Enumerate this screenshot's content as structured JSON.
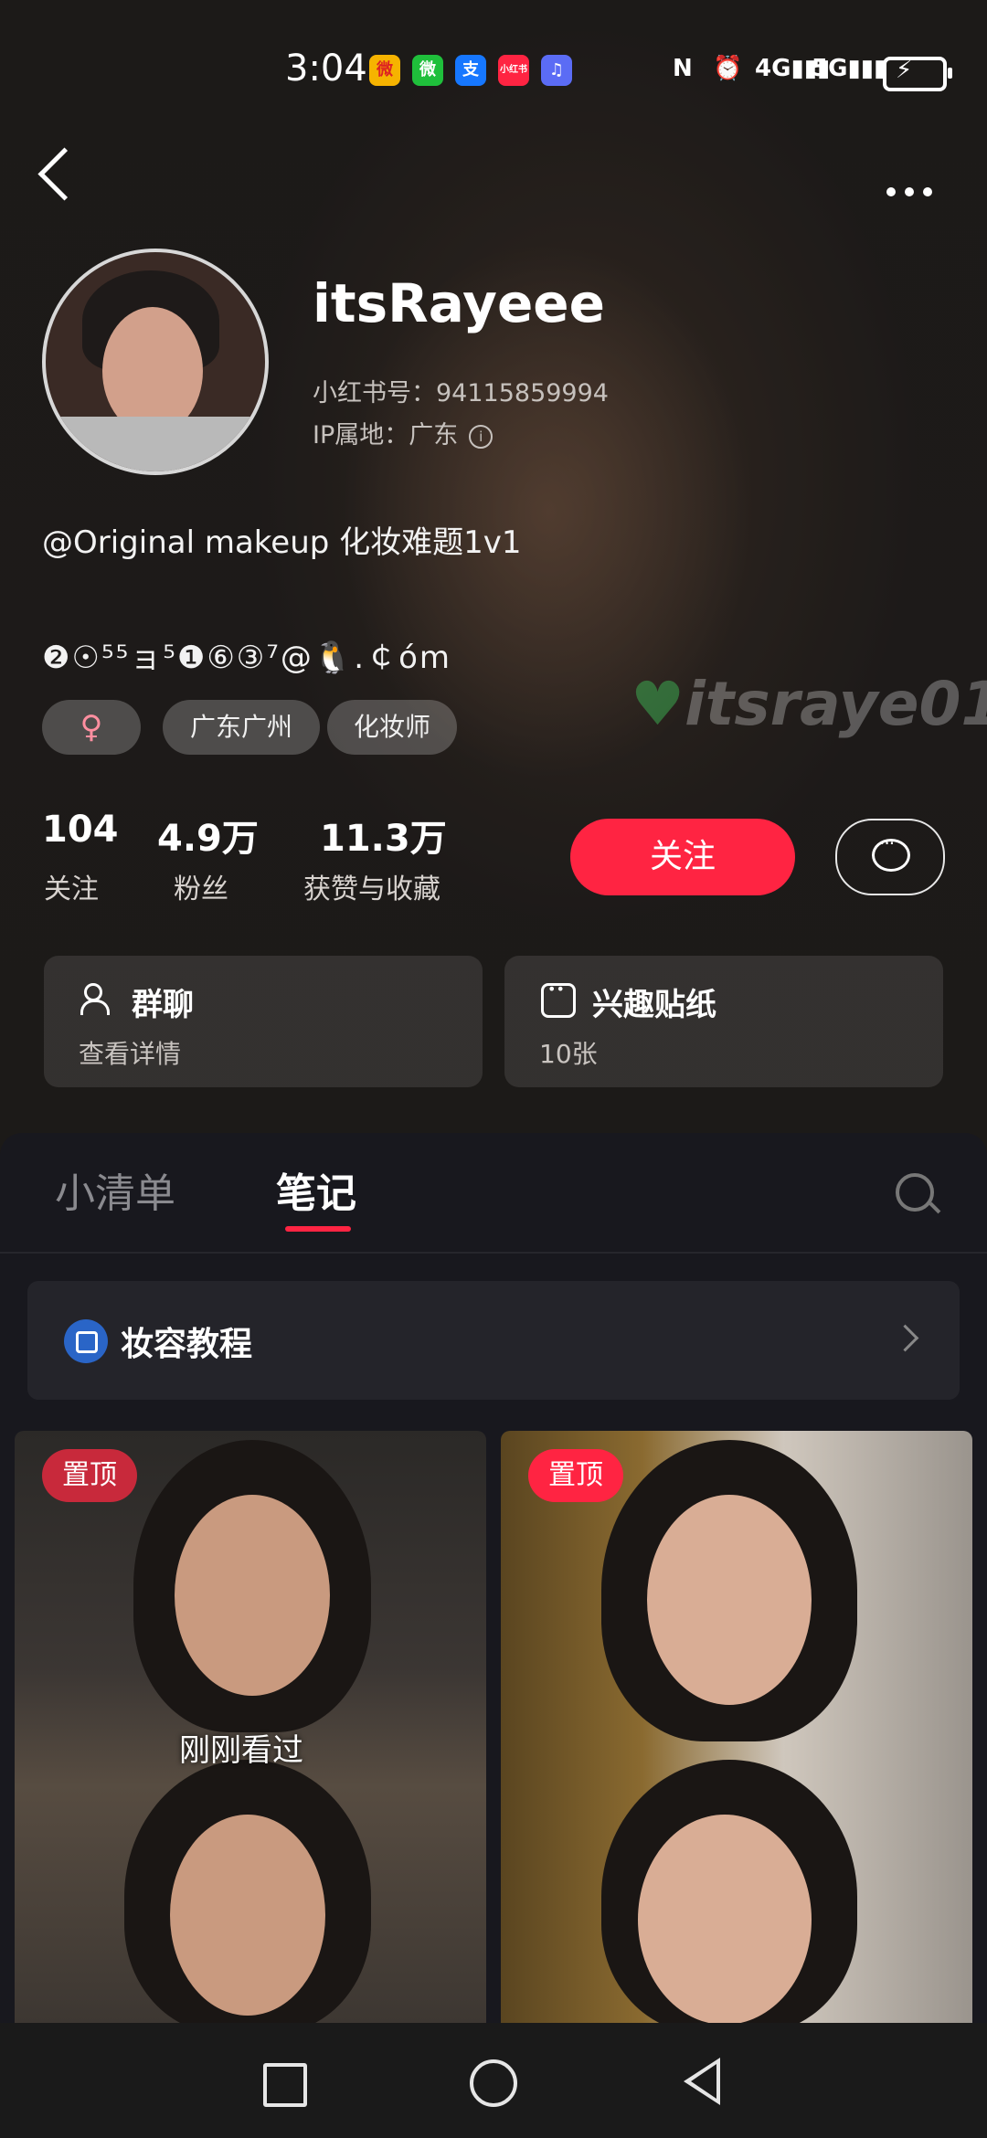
{
  "status_bar": {
    "time": "3:04",
    "apps": [
      "微",
      "微",
      "支",
      "小红书",
      "♫"
    ],
    "network_4g": "4G",
    "network_5g": "5G"
  },
  "profile": {
    "username": "itsRayeee",
    "red_id": "小红书号：94115859994",
    "ip_location": "IP属地：广东",
    "bio_line1": "@Original makeup 化妆难题1v1",
    "bio_line2": "❷☉⁵⁵ョ⁵❶⑥③⁷@🐧.￠óm",
    "tags": [
      "♀",
      "广东广州",
      "化妆师"
    ],
    "watermark": "itsraye01"
  },
  "stats": [
    {
      "value": "104",
      "label": "关注"
    },
    {
      "value": "4.9万",
      "label": "粉丝"
    },
    {
      "value": "11.3万",
      "label": "获赞与收藏"
    }
  ],
  "actions": {
    "follow_label": "关注"
  },
  "cards": [
    {
      "title": "群聊",
      "subtitle": "查看详情"
    },
    {
      "title": "兴趣贴纸",
      "subtitle": "10张"
    }
  ],
  "tabs": [
    "小清单",
    "笔记"
  ],
  "collection": {
    "title": "妆容教程"
  },
  "notes": {
    "pinned_label": "置顶",
    "recently_viewed": "刚刚看过"
  },
  "colors": {
    "accent": "#ff2442",
    "pin": "#c8293b",
    "panel": "#18181e"
  }
}
